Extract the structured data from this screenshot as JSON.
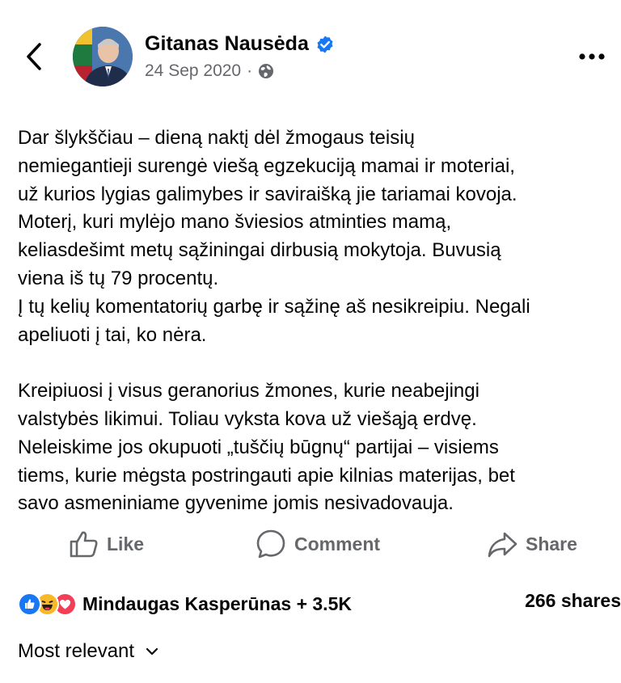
{
  "post": {
    "author": "Gitanas Nausėda",
    "date": "24 Sep 2020",
    "separator": "·",
    "verified": true,
    "lines": [
      "Dar šlykščiau – dieną naktį dėl žmogaus teisių",
      "nemiegantieji surengė viešą egzekuciją mamai ir moteriai,",
      "už kurios lygias galimybes ir saviraišką jie tariamai kovoja.",
      "Moterį, kuri mylėjo mano šviesios atminties mamą,",
      "keliasdešimt metų sąžiningai dirbusią mokytoja. Buvusią",
      "viena iš tų 79 procentų.",
      "Į tų kelių komentatorių garbę ir sąžinę aš nesikreipiu. Negali",
      "apeliuoti į tai, ko nėra.",
      "",
      "Kreipiuosi į visus geranorius žmones, kurie neabejingi",
      "valstybės likimui. Toliau vyksta kova už viešąją erdvę.",
      "Neleiskime jos okupuoti „tuščių būgnų“ partijai – visiems",
      "tiems, kurie mėgsta postringauti apie kilnias materijas, bet",
      "savo asmeniniame gyvenime jomis nesivadovauja."
    ]
  },
  "actions": {
    "like": "Like",
    "comment": "Comment",
    "share": "Share"
  },
  "reactions": {
    "summary": "Mindaugas Kasperūnas + 3.5K",
    "shares": "266 shares",
    "icons": [
      "like-icon",
      "haha-icon",
      "love-icon"
    ]
  },
  "comments": {
    "sort_label": "Most relevant"
  },
  "colors": {
    "verified": "#1877f2",
    "like": "#1877f2",
    "haha": "#f7b928",
    "love": "#f33e58",
    "muted": "#65676b"
  }
}
